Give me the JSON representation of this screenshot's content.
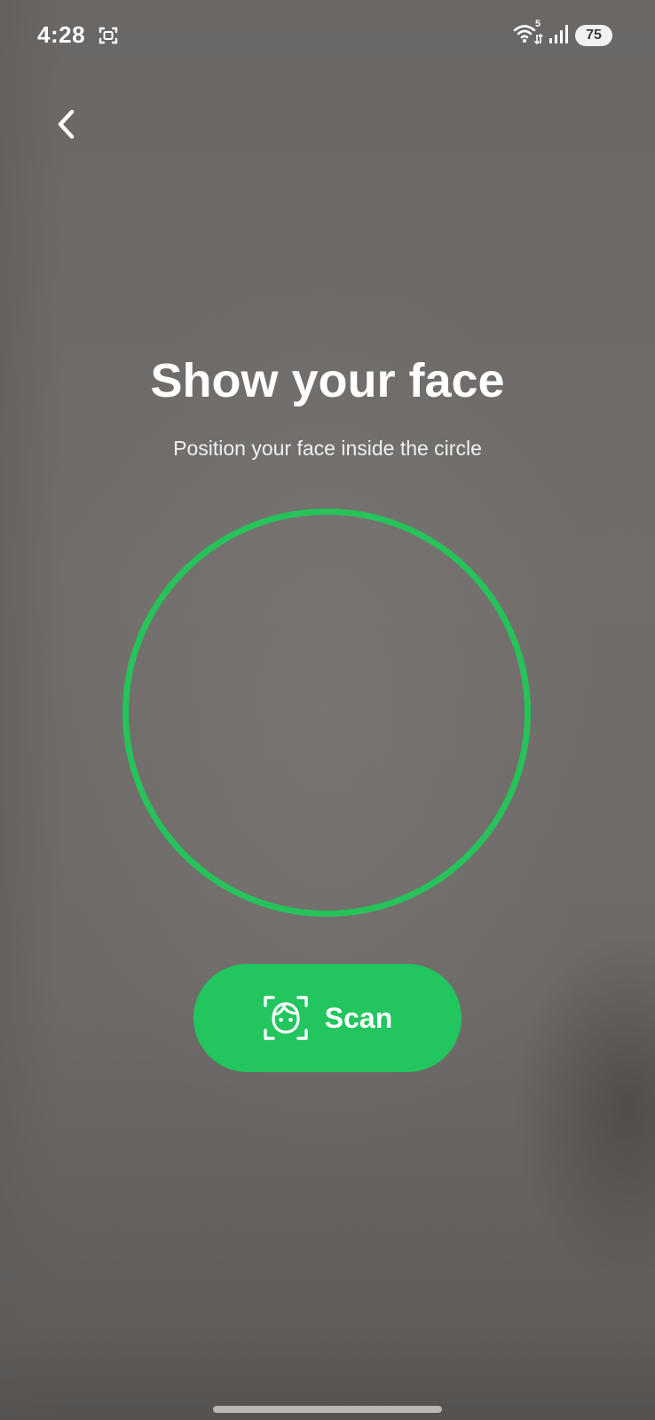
{
  "status_bar": {
    "time": "4:28",
    "wifi_superscript": "5",
    "battery_level": "75",
    "icons": [
      "screenshot-icon",
      "wifi-icon",
      "signal-icon",
      "battery-icon"
    ]
  },
  "header": {
    "back_icon": "chevron-left-icon"
  },
  "main": {
    "title": "Show your face",
    "subtitle": "Position your face inside the circle",
    "circle_color": "#25c35a"
  },
  "scan_button": {
    "label": "Scan",
    "icon": "face-scan-icon",
    "color": "#22c55e"
  }
}
